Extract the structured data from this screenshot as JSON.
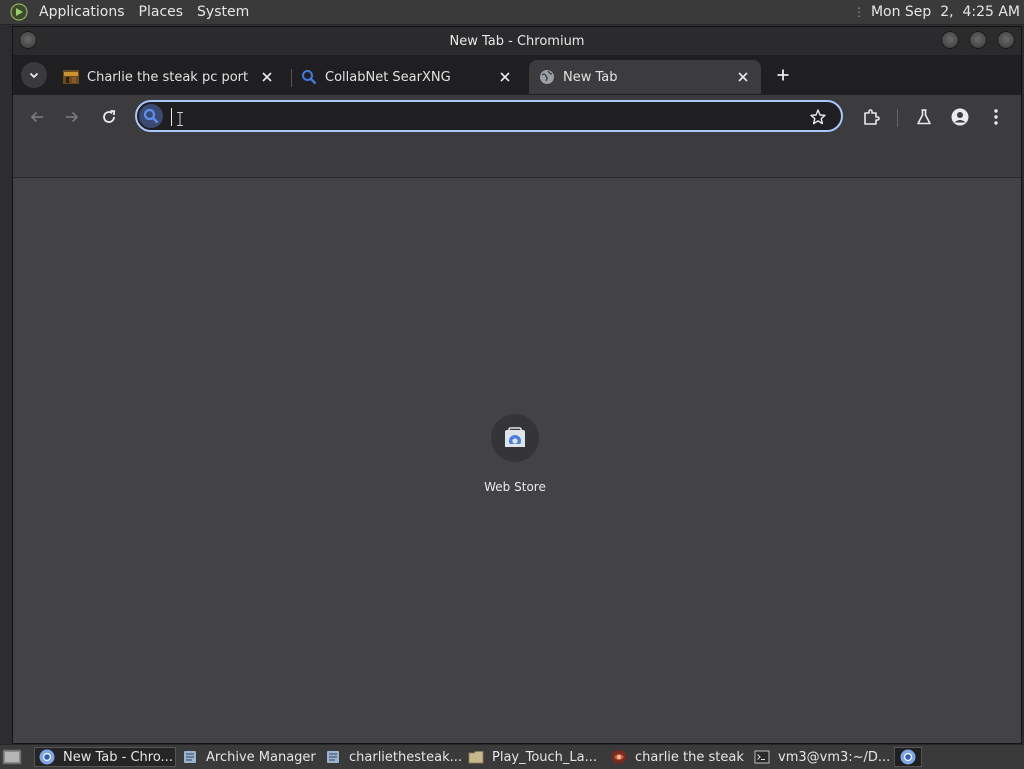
{
  "top_panel": {
    "menus": [
      "Applications",
      "Places",
      "System"
    ],
    "clock": "Mon Sep  2,  4:25 AM"
  },
  "window": {
    "title": "New Tab - Chromium"
  },
  "tabs": [
    {
      "title": "Charlie the steak pc port by ",
      "favicon": "game-thumbnail-icon",
      "active": false
    },
    {
      "title": "CollabNet SearXNG",
      "favicon": "search-icon",
      "active": false
    },
    {
      "title": "New Tab",
      "favicon": "globe-icon",
      "active": true
    }
  ],
  "omnibox": {
    "value": "",
    "placeholder": ""
  },
  "new_tab_page": {
    "shortcuts": [
      {
        "label": "Web Store",
        "icon": "web-store-icon"
      }
    ]
  },
  "taskbar": {
    "items": [
      {
        "label": "New Tab - Chro...",
        "icon": "chromium-icon",
        "active": true
      },
      {
        "label": "Archive Manager",
        "icon": "archive-manager-icon",
        "active": false
      },
      {
        "label": "charliethesteak....",
        "icon": "archive-file-icon",
        "active": false
      },
      {
        "label": "Play_Touch_La...",
        "icon": "folder-icon",
        "active": false
      },
      {
        "label": "charlie the steak",
        "icon": "game-icon",
        "active": false
      },
      {
        "label": "vm3@vm3:~/D...",
        "icon": "terminal-icon",
        "active": false
      }
    ]
  },
  "colors": {
    "accent": "#a8c7fa",
    "toolbar": "#3c3c3f",
    "page_background": "#434346",
    "panel": "#3a3a3a"
  }
}
